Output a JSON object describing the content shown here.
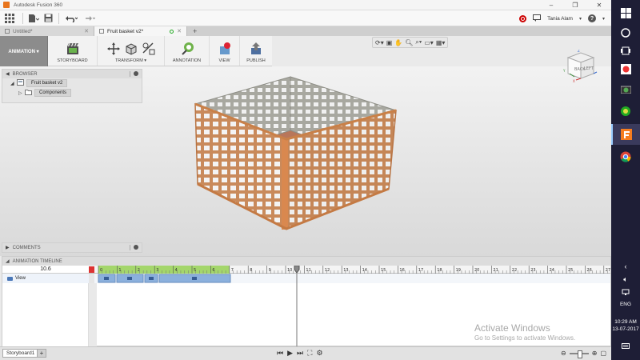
{
  "window": {
    "title": "Autodesk Fusion 360",
    "minimize": "–",
    "restore": "❐",
    "close": "✕"
  },
  "qat": {
    "user": "Tania Alam",
    "help": "?"
  },
  "tabs": [
    {
      "label": "Untitled*"
    },
    {
      "label": "Fruit basket v2*"
    }
  ],
  "ribbon": {
    "workspace": "ANIMATION ▾",
    "groups": [
      {
        "label": "STORYBOARD"
      },
      {
        "label": "TRANSFORM ▾"
      },
      {
        "label": "ANNOTATION"
      },
      {
        "label": "VIEW"
      },
      {
        "label": "PUBLISH"
      }
    ]
  },
  "viewcube": {
    "faces": [
      "BACK",
      "LEFT"
    ],
    "axes": [
      "Y",
      "X",
      "Z"
    ]
  },
  "browser": {
    "title": "BROWSER",
    "items": [
      {
        "label": "Fruit basket v2"
      },
      {
        "label": "Components"
      }
    ]
  },
  "comments": {
    "title": "COMMENTS"
  },
  "timeline": {
    "title": "ANIMATION TIMELINE",
    "current_time": "10.6",
    "view_label": "View",
    "ruler": [
      "0",
      "1",
      "2",
      "3",
      "4",
      "5",
      "6",
      "7",
      "8",
      "9",
      "10",
      "11",
      "12",
      "13",
      "14",
      "15",
      "16",
      "17",
      "18",
      "19",
      "20",
      "21",
      "22",
      "23",
      "24",
      "25",
      "26",
      "27"
    ]
  },
  "bottombar": {
    "storyboard_tab": "Storyboard1",
    "add": "+"
  },
  "watermark": {
    "line1": "Activate Windows",
    "line2": "Go to Settings to activate Windows."
  },
  "taskbar": {
    "language": "ENG",
    "time": "10:29 AM",
    "date": "13-07-2017"
  }
}
